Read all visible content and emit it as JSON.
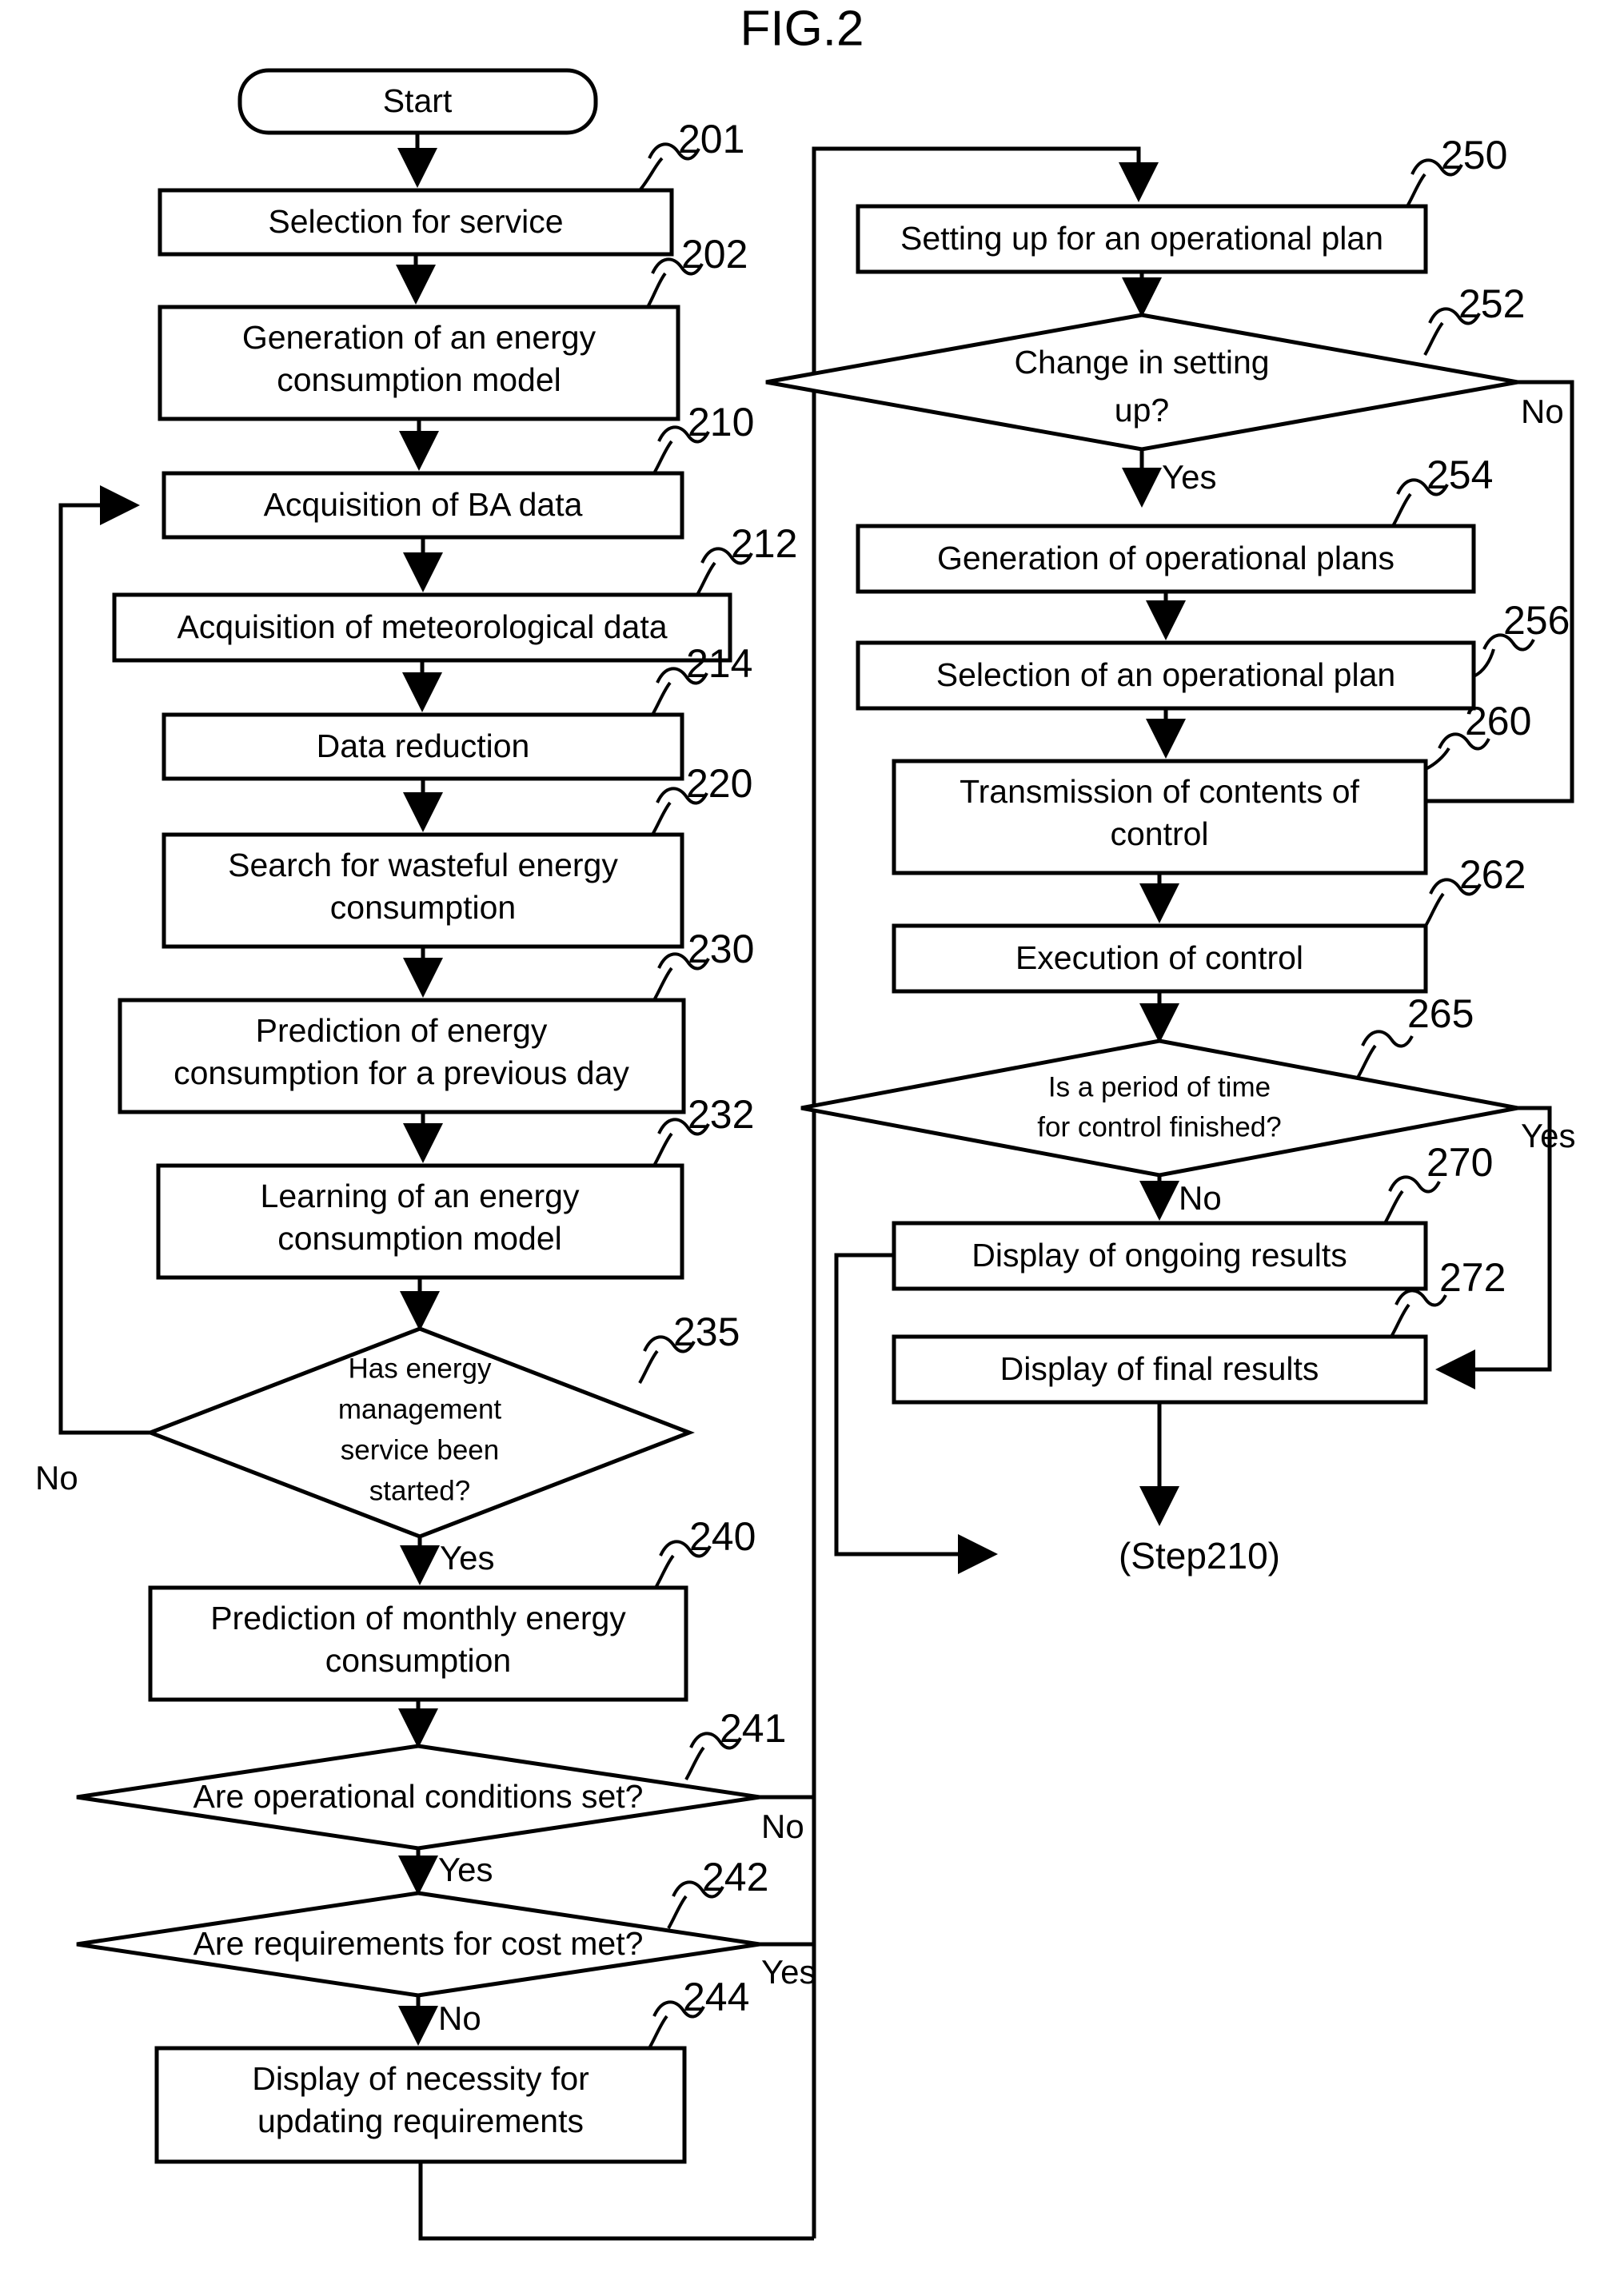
{
  "figure": {
    "title": "FIG.2"
  },
  "chart_data": {
    "type": "diagram",
    "title": "FIG.2",
    "diagram_kind": "flowchart",
    "columns": 2,
    "nodes": [
      {
        "id": "start",
        "ref": "",
        "shape": "rounded",
        "text": "Start"
      },
      {
        "id": "n201",
        "ref": "201",
        "shape": "process",
        "text": "Selection for service"
      },
      {
        "id": "n202",
        "ref": "202",
        "shape": "process",
        "text": "Generation of an energy consumption model"
      },
      {
        "id": "n210",
        "ref": "210",
        "shape": "process",
        "text": "Acquisition of BA data"
      },
      {
        "id": "n212",
        "ref": "212",
        "shape": "process",
        "text": "Acquisition of meteorological data"
      },
      {
        "id": "n214",
        "ref": "214",
        "shape": "process",
        "text": "Data reduction"
      },
      {
        "id": "n220",
        "ref": "220",
        "shape": "process",
        "text": "Search for wasteful energy consumption"
      },
      {
        "id": "n230",
        "ref": "230",
        "shape": "process",
        "text": "Prediction of energy consumption for a previous day"
      },
      {
        "id": "n232",
        "ref": "232",
        "shape": "process",
        "text": "Learning of an energy consumption model"
      },
      {
        "id": "n235",
        "ref": "235",
        "shape": "decision",
        "text": "Has energy management service been started?"
      },
      {
        "id": "n240",
        "ref": "240",
        "shape": "process",
        "text": "Prediction of monthly energy consumption"
      },
      {
        "id": "n241",
        "ref": "241",
        "shape": "decision",
        "text": "Are operational conditions set?"
      },
      {
        "id": "n242",
        "ref": "242",
        "shape": "decision",
        "text": "Are requirements for cost met?"
      },
      {
        "id": "n244",
        "ref": "244",
        "shape": "process",
        "text": "Display of necessity for updating requirements"
      },
      {
        "id": "n250",
        "ref": "250",
        "shape": "process",
        "text": "Setting up for an operational plan"
      },
      {
        "id": "n252",
        "ref": "252",
        "shape": "decision",
        "text": "Change in setting up?"
      },
      {
        "id": "n254",
        "ref": "254",
        "shape": "process",
        "text": "Generation of operational plans"
      },
      {
        "id": "n256",
        "ref": "256",
        "shape": "process",
        "text": "Selection of an operational plan"
      },
      {
        "id": "n260",
        "ref": "260",
        "shape": "process",
        "text": "Transmission of contents of control"
      },
      {
        "id": "n262",
        "ref": "262",
        "shape": "process",
        "text": "Execution of control"
      },
      {
        "id": "n265",
        "ref": "265",
        "shape": "decision",
        "text": "Is a period of time for control finished?"
      },
      {
        "id": "n270",
        "ref": "270",
        "shape": "process",
        "text": "Display of ongoing results"
      },
      {
        "id": "n272",
        "ref": "272",
        "shape": "process",
        "text": "Display of final results"
      },
      {
        "id": "nstep210",
        "ref": "",
        "shape": "text",
        "text": "(Step210)"
      }
    ],
    "branch_labels": [
      {
        "from": "n235",
        "label": "No",
        "direction": "left"
      },
      {
        "from": "n235",
        "label": "Yes",
        "direction": "down"
      },
      {
        "from": "n241",
        "label": "No",
        "direction": "right"
      },
      {
        "from": "n241",
        "label": "Yes",
        "direction": "down"
      },
      {
        "from": "n242",
        "label": "Yes",
        "direction": "right"
      },
      {
        "from": "n242",
        "label": "No",
        "direction": "down"
      },
      {
        "from": "n252",
        "label": "No",
        "direction": "right"
      },
      {
        "from": "n252",
        "label": "Yes",
        "direction": "down"
      },
      {
        "from": "n265",
        "label": "Yes",
        "direction": "right"
      },
      {
        "from": "n265",
        "label": "No",
        "direction": "down"
      }
    ],
    "edges": [
      {
        "from": "start",
        "to": "n201"
      },
      {
        "from": "n201",
        "to": "n202"
      },
      {
        "from": "n202",
        "to": "n210"
      },
      {
        "from": "n210",
        "to": "n212"
      },
      {
        "from": "n212",
        "to": "n214"
      },
      {
        "from": "n214",
        "to": "n220"
      },
      {
        "from": "n220",
        "to": "n230"
      },
      {
        "from": "n230",
        "to": "n232"
      },
      {
        "from": "n232",
        "to": "n235"
      },
      {
        "from": "n235",
        "to": "n210",
        "label": "No"
      },
      {
        "from": "n235",
        "to": "n240",
        "label": "Yes"
      },
      {
        "from": "n240",
        "to": "n241"
      },
      {
        "from": "n241",
        "to": "n242",
        "label": "Yes"
      },
      {
        "from": "n241",
        "to": "n250",
        "label": "No"
      },
      {
        "from": "n242",
        "to": "n244",
        "label": "No"
      },
      {
        "from": "n242",
        "to": "n250",
        "label": "Yes"
      },
      {
        "from": "n244",
        "to": "n250"
      },
      {
        "from": "n250",
        "to": "n252"
      },
      {
        "from": "n252",
        "to": "n254",
        "label": "Yes"
      },
      {
        "from": "n252",
        "to": "n260",
        "label": "No"
      },
      {
        "from": "n254",
        "to": "n256"
      },
      {
        "from": "n256",
        "to": "n260"
      },
      {
        "from": "n260",
        "to": "n262"
      },
      {
        "from": "n262",
        "to": "n265"
      },
      {
        "from": "n265",
        "to": "n270",
        "label": "No"
      },
      {
        "from": "n265",
        "to": "n272",
        "label": "Yes"
      },
      {
        "from": "n270",
        "to": "nstep210"
      },
      {
        "from": "n272",
        "to": "nstep210"
      }
    ]
  },
  "labels": {
    "start": "Start",
    "n201": "Selection for service",
    "n202_l1": "Generation of an energy",
    "n202_l2": "consumption model",
    "n210": "Acquisition of BA data",
    "n212": "Acquisition of meteorological data",
    "n214": "Data reduction",
    "n220_l1": "Search for wasteful energy",
    "n220_l2": "consumption",
    "n230_l1": "Prediction of energy",
    "n230_l2": "consumption for a previous day",
    "n232_l1": "Learning of an energy",
    "n232_l2": "consumption model",
    "n235_l1": "Has energy",
    "n235_l2": "management",
    "n235_l3": "service been",
    "n235_l4": "started?",
    "n240_l1": "Prediction of monthly energy",
    "n240_l2": "consumption",
    "n241": "Are operational conditions set?",
    "n242": "Are requirements for cost met?",
    "n244_l1": "Display of necessity for",
    "n244_l2": "updating requirements",
    "n250": "Setting up for an operational plan",
    "n252_l1": "Change in setting",
    "n252_l2": "up?",
    "n254": "Generation of operational plans",
    "n256": "Selection of an operational plan",
    "n260_l1": "Transmission of contents of",
    "n260_l2": "control",
    "n262": "Execution of control",
    "n265_l1": "Is a period of time",
    "n265_l2": "for control finished?",
    "n270": "Display of ongoing results",
    "n272": "Display of final results",
    "step210": "(Step210)"
  },
  "refs": {
    "r201": "201",
    "r202": "202",
    "r210": "210",
    "r212": "212",
    "r214": "214",
    "r220": "220",
    "r230": "230",
    "r232": "232",
    "r235": "235",
    "r240": "240",
    "r241": "241",
    "r242": "242",
    "r244": "244",
    "r250": "250",
    "r252": "252",
    "r254": "254",
    "r256": "256",
    "r260": "260",
    "r262": "262",
    "r265": "265",
    "r270": "270",
    "r272": "272"
  },
  "branches": {
    "b235_no": "No",
    "b235_yes": "Yes",
    "b241_no": "No",
    "b241_yes": "Yes",
    "b242_yes": "Yes",
    "b242_no": "No",
    "b252_no": "No",
    "b252_yes": "Yes",
    "b265_yes": "Yes",
    "b265_no": "No"
  },
  "colors": {
    "stroke": "#000000",
    "fill": "#ffffff",
    "text": "#000000"
  }
}
